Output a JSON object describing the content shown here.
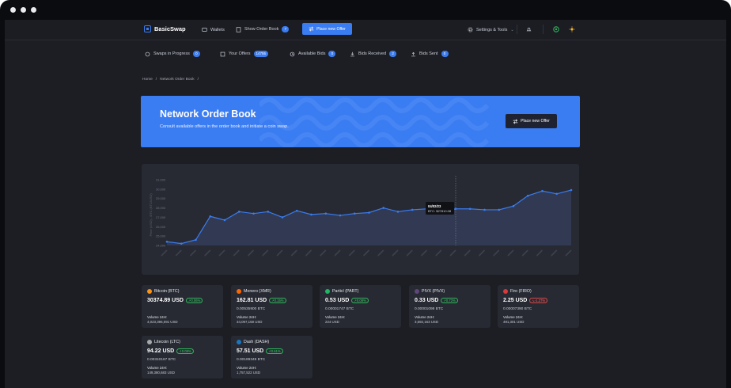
{
  "brand": {
    "name": "BasicSwap"
  },
  "topnav": {
    "wallets": "Wallets",
    "show_order_book": "Show Order Book",
    "order_book_count": "7",
    "place_new_offer": "Place new Offer",
    "settings_tools": "Settings & Tools"
  },
  "subnav": {
    "swaps_in_progress": "Swaps in Progress",
    "swaps_count": "0",
    "your_offers": "Your Offers",
    "your_offers_count": "14755",
    "available_bids": "Available Bids",
    "available_bids_count": "0",
    "bids_received": "Bids Received",
    "bids_received_count": "2",
    "bids_sent": "Bids Sent",
    "bids_sent_count": "0"
  },
  "breadcrumb": {
    "home": "Home",
    "current": "Network Order Book"
  },
  "hero": {
    "title": "Network Order Book",
    "subtitle": "Consult available offers in the order book and initiate a coin swap.",
    "button": "Place new Offer"
  },
  "chart_data": {
    "type": "area",
    "ylabel": "Price (USD) - BTC (BTC/USD)",
    "yticks": [
      "24,000",
      "25,000",
      "26,000",
      "27,000",
      "28,000",
      "29,000",
      "30,000",
      "31,000"
    ],
    "ylim": [
      24000,
      31000
    ],
    "values": [
      24400,
      24200,
      24600,
      27100,
      26700,
      27600,
      27400,
      27600,
      27000,
      27700,
      27300,
      27400,
      27200,
      27400,
      27500,
      28000,
      27600,
      27800,
      27900,
      27600,
      27900,
      27900,
      27800,
      27800,
      28200,
      29300,
      29800,
      29500,
      29900
    ],
    "tooltip": {
      "date": "04/02/23",
      "value": "BTC: $27810.08"
    },
    "color": "#3a7cf2"
  },
  "coins": [
    {
      "name": "Bitcoin (BTC)",
      "price": "30374.89 USD",
      "change": "↗0.06%",
      "negative": false,
      "btc": "",
      "volume_label": "Volume 24H:",
      "volume": "4,023,396,091 USD",
      "color": "#f7931a"
    },
    {
      "name": "Monero (XMR)",
      "price": "162.81 USD",
      "change": "↗0.15%",
      "negative": false,
      "btc": "0.00535900 BTC",
      "volume_label": "Volume 24H:",
      "volume": "34,097,158 USD",
      "color": "#ff6600"
    },
    {
      "name": "Particl (PART)",
      "price": "0.53 USD",
      "change": "↗0.08%",
      "negative": false,
      "btc": "0.00001747 BTC",
      "volume_label": "Volume 24H:",
      "volume": "224 USD",
      "color": "#21b565"
    },
    {
      "name": "PIVX (PIVX)",
      "price": "0.33 USD",
      "change": "↗0.72%",
      "negative": false,
      "btc": "0.00001098 BTC",
      "volume_label": "Volume 24H:",
      "volume": "3,592,163 USD",
      "color": "#5e4778"
    },
    {
      "name": "Firo (FIRO)",
      "price": "2.25 USD",
      "change": "↘-1.27%",
      "negative": true,
      "btc": "0.00007390 BTC",
      "volume_label": "Volume 24H:",
      "volume": "491,301 USD",
      "color": "#d63a3a"
    },
    {
      "name": "Litecoin (LTC)",
      "price": "94.22 USD",
      "change": "↗0.08%",
      "negative": false,
      "btc": "0.00310167 BTC",
      "volume_label": "Volume 24H:",
      "volume": "149,380,683 USD",
      "color": "#a6a9aa"
    },
    {
      "name": "Dash (DASH)",
      "price": "57.51 USD",
      "change": "↗0.61%",
      "negative": false,
      "btc": "0.00189349 BTC",
      "volume_label": "Volume 24H:",
      "volume": "1,757,522 USD",
      "color": "#1c75bc"
    }
  ]
}
